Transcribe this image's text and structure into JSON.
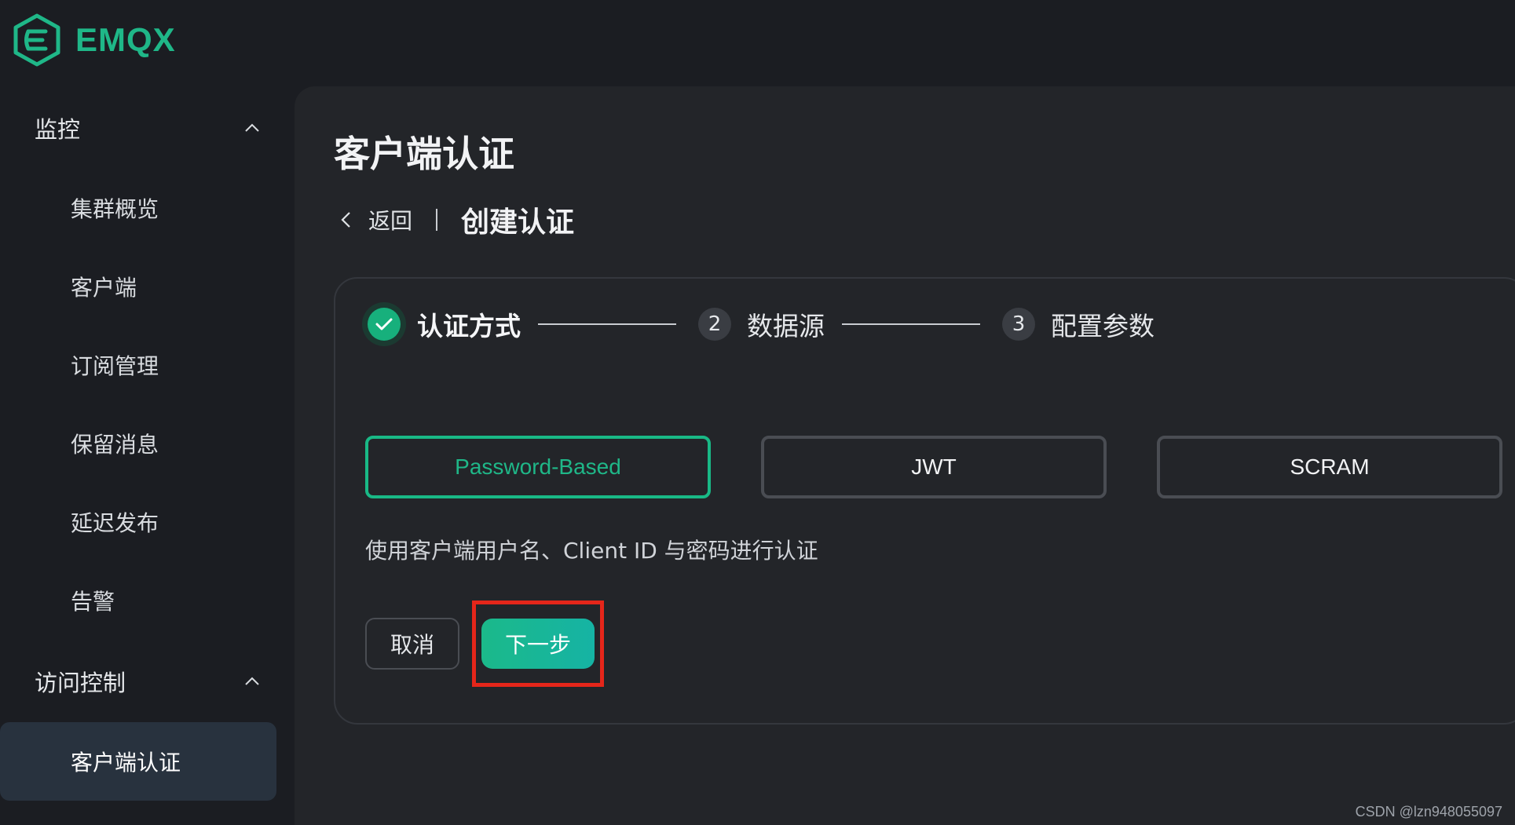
{
  "brand": {
    "name": "EMQX",
    "color": "#1fb788",
    "icon": "emqx-hexagon-logo-icon"
  },
  "sidebar": {
    "groups": [
      {
        "label": "监控",
        "icon": "chevron-up-icon"
      },
      {
        "label": "访问控制",
        "icon": "chevron-up-icon"
      }
    ],
    "items": [
      {
        "label": "集群概览"
      },
      {
        "label": "客户端"
      },
      {
        "label": "订阅管理"
      },
      {
        "label": "保留消息"
      },
      {
        "label": "延迟发布"
      },
      {
        "label": "告警"
      },
      {
        "label": "客户端认证",
        "active": true
      }
    ]
  },
  "main": {
    "title": "客户端认证",
    "breadcrumb": {
      "back": "返回",
      "current": "创建认证"
    },
    "steps": [
      {
        "label": "认证方式",
        "status": "done",
        "icon": "check-icon"
      },
      {
        "number": "2",
        "label": "数据源"
      },
      {
        "number": "3",
        "label": "配置参数"
      }
    ],
    "options": [
      {
        "label": "Password-Based",
        "selected": true
      },
      {
        "label": "JWT"
      },
      {
        "label": "SCRAM"
      }
    ],
    "description": "使用客户端用户名、Client ID 与密码进行认证",
    "actions": {
      "cancel": "取消",
      "next": "下一步"
    },
    "highlight_color": "#e5261a"
  },
  "watermark": "CSDN @lzn948055097"
}
